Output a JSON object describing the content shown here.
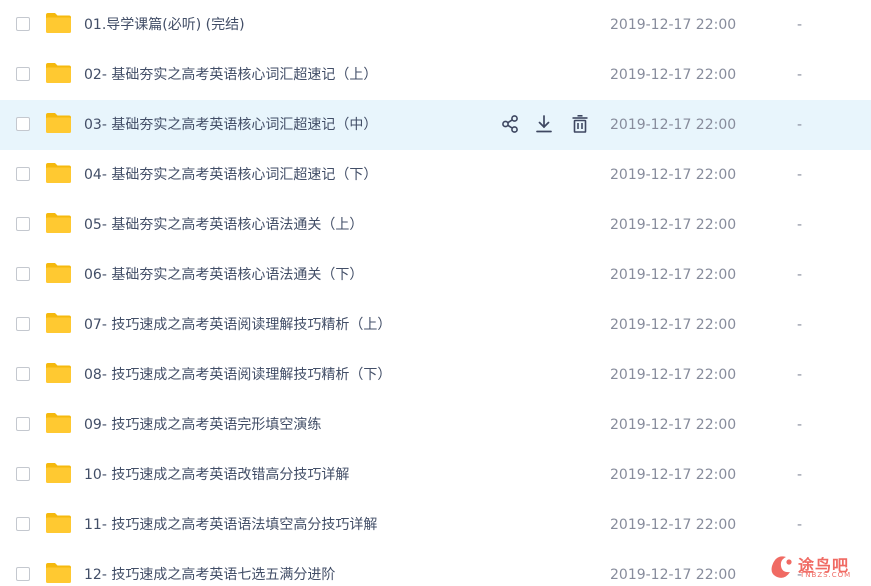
{
  "icons": {
    "checkbox": "checkbox-icon",
    "folder": "folder-icon",
    "share": "share-icon",
    "download": "download-icon",
    "delete": "trash-icon"
  },
  "colors": {
    "folder": "#ffc931",
    "folder_tab": "#f5b90e",
    "hover_row": "#e8f5fc",
    "name_text": "#424e67",
    "meta_text": "#878c9c",
    "action_icon": "#3e4761",
    "watermark": "#f06a63"
  },
  "files": [
    {
      "name": "01.导学课篇(必听) (完结)",
      "modified": "2019-12-17 22:00",
      "size": "-"
    },
    {
      "name": "02- 基础夯实之高考英语核心词汇超速记（上）",
      "modified": "2019-12-17 22:00",
      "size": "-"
    },
    {
      "name": "03- 基础夯实之高考英语核心词汇超速记（中）",
      "modified": "2019-12-17 22:00",
      "size": "-",
      "hovered": true
    },
    {
      "name": "04- 基础夯实之高考英语核心词汇超速记（下）",
      "modified": "2019-12-17 22:00",
      "size": "-"
    },
    {
      "name": "05- 基础夯实之高考英语核心语法通关（上）",
      "modified": "2019-12-17 22:00",
      "size": "-"
    },
    {
      "name": "06- 基础夯实之高考英语核心语法通关（下）",
      "modified": "2019-12-17 22:00",
      "size": "-"
    },
    {
      "name": "07- 技巧速成之高考英语阅读理解技巧精析（上）",
      "modified": "2019-12-17 22:00",
      "size": "-"
    },
    {
      "name": "08- 技巧速成之高考英语阅读理解技巧精析（下）",
      "modified": "2019-12-17 22:00",
      "size": "-"
    },
    {
      "name": "09- 技巧速成之高考英语完形填空演练",
      "modified": "2019-12-17 22:00",
      "size": "-"
    },
    {
      "name": "10- 技巧速成之高考英语改错高分技巧详解",
      "modified": "2019-12-17 22:00",
      "size": "-"
    },
    {
      "name": "11- 技巧速成之高考英语语法填空高分技巧详解",
      "modified": "2019-12-17 22:00",
      "size": "-"
    },
    {
      "name": "12- 技巧速成之高考英语七选五满分进阶",
      "modified": "2019-12-17 22:00",
      "size": "-"
    }
  ],
  "watermark": {
    "text": "途鸟吧",
    "sub": "TNBZS.COM"
  }
}
